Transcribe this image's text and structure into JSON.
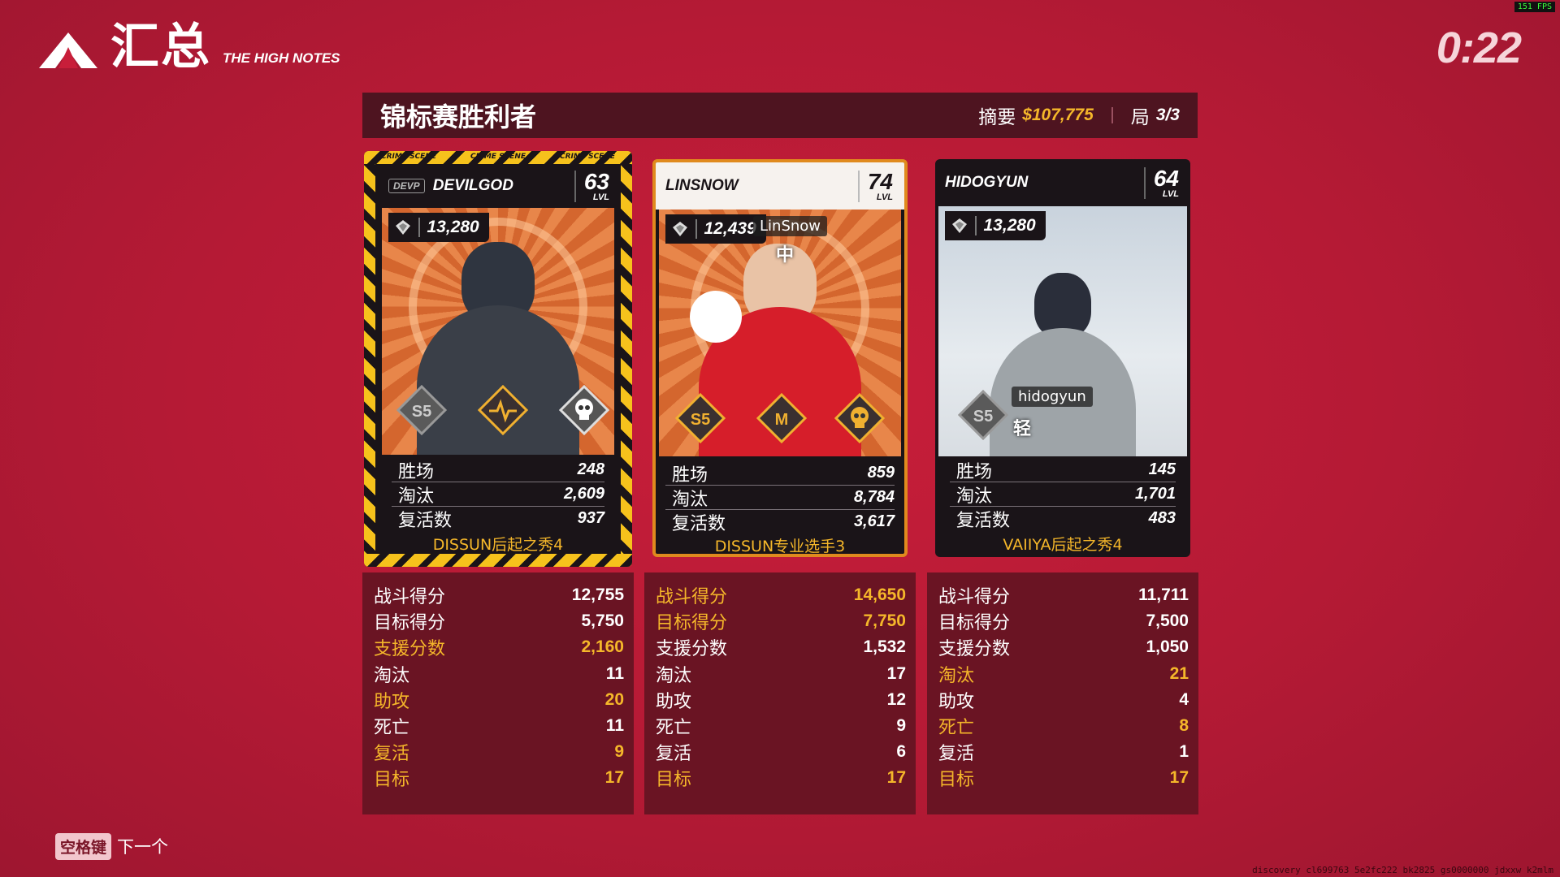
{
  "header": {
    "page_title": "汇总",
    "mode_name": "THE HIGH NOTES",
    "timer": "0:22",
    "fps": "151 FPS",
    "build_info": "discovery cl699763 5e2fc222 bk2825 gs0000000 jdxxw k2mlm"
  },
  "banner": {
    "title": "锦标赛胜利者",
    "summary_label": "摘要",
    "summary_value": "$107,775",
    "round_label": "局",
    "round_value": "3/3"
  },
  "cards": [
    {
      "club_tag": "DEVP",
      "name": "DEVILGOD",
      "level": "63",
      "level_label": "LVL",
      "rank_score": "13,280",
      "tape_text": "CRIME SCENE",
      "badges": [
        "S5",
        "heartbeat-icon",
        "skull-icon"
      ],
      "stats": [
        {
          "label": "胜场",
          "value": "248"
        },
        {
          "label": "淘汰",
          "value": "2,609"
        },
        {
          "label": "复活数",
          "value": "937"
        }
      ],
      "title": "DISSUN后起之秀4"
    },
    {
      "name": "LINSNOW",
      "level": "74",
      "level_label": "LVL",
      "rank_score": "12,439",
      "nametag": "LinSnow",
      "sub_tag": "中",
      "badges": [
        "S5",
        "M",
        "skull-icon"
      ],
      "stats": [
        {
          "label": "胜场",
          "value": "859"
        },
        {
          "label": "淘汰",
          "value": "8,784"
        },
        {
          "label": "复活数",
          "value": "3,617"
        }
      ],
      "title": "DISSUN专业选手3"
    },
    {
      "name": "HIDOGYUN",
      "level": "64",
      "level_label": "LVL",
      "rank_score": "13,280",
      "nametag": "hidogyun",
      "sub_tag": "轻",
      "badges": [
        "S5"
      ],
      "stats": [
        {
          "label": "胜场",
          "value": "145"
        },
        {
          "label": "淘汰",
          "value": "1,701"
        },
        {
          "label": "复活数",
          "value": "483"
        }
      ],
      "title": "VAIIYA后起之秀4"
    }
  ],
  "panels": [
    {
      "rows": [
        {
          "label": "战斗得分",
          "value": "12,755",
          "highlight": false
        },
        {
          "label": "目标得分",
          "value": "5,750",
          "highlight": false
        },
        {
          "label": "支援分数",
          "value": "2,160",
          "highlight": true
        },
        {
          "label": "淘汰",
          "value": "11",
          "highlight": false
        },
        {
          "label": "助攻",
          "value": "20",
          "highlight": true
        },
        {
          "label": "死亡",
          "value": "11",
          "highlight": false
        },
        {
          "label": "复活",
          "value": "9",
          "highlight": true
        },
        {
          "label": "目标",
          "value": "17",
          "highlight": true
        }
      ]
    },
    {
      "rows": [
        {
          "label": "战斗得分",
          "value": "14,650",
          "highlight": true
        },
        {
          "label": "目标得分",
          "value": "7,750",
          "highlight": true
        },
        {
          "label": "支援分数",
          "value": "1,532",
          "highlight": false
        },
        {
          "label": "淘汰",
          "value": "17",
          "highlight": false
        },
        {
          "label": "助攻",
          "value": "12",
          "highlight": false
        },
        {
          "label": "死亡",
          "value": "9",
          "highlight": false
        },
        {
          "label": "复活",
          "value": "6",
          "highlight": false
        },
        {
          "label": "目标",
          "value": "17",
          "highlight": true
        }
      ]
    },
    {
      "rows": [
        {
          "label": "战斗得分",
          "value": "11,711",
          "highlight": false
        },
        {
          "label": "目标得分",
          "value": "7,500",
          "highlight": false
        },
        {
          "label": "支援分数",
          "value": "1,050",
          "highlight": false
        },
        {
          "label": "淘汰",
          "value": "21",
          "highlight": true
        },
        {
          "label": "助攻",
          "value": "4",
          "highlight": false
        },
        {
          "label": "死亡",
          "value": "8",
          "highlight": true
        },
        {
          "label": "复活",
          "value": "1",
          "highlight": false
        },
        {
          "label": "目标",
          "value": "17",
          "highlight": true
        }
      ]
    }
  ],
  "footer": {
    "key_label": "空格键",
    "action_label": "下一个"
  },
  "colors": {
    "background": "#c81e3a",
    "accent_gold": "#f5b72a",
    "panel": "#6a1423",
    "banner": "#4e1420"
  }
}
